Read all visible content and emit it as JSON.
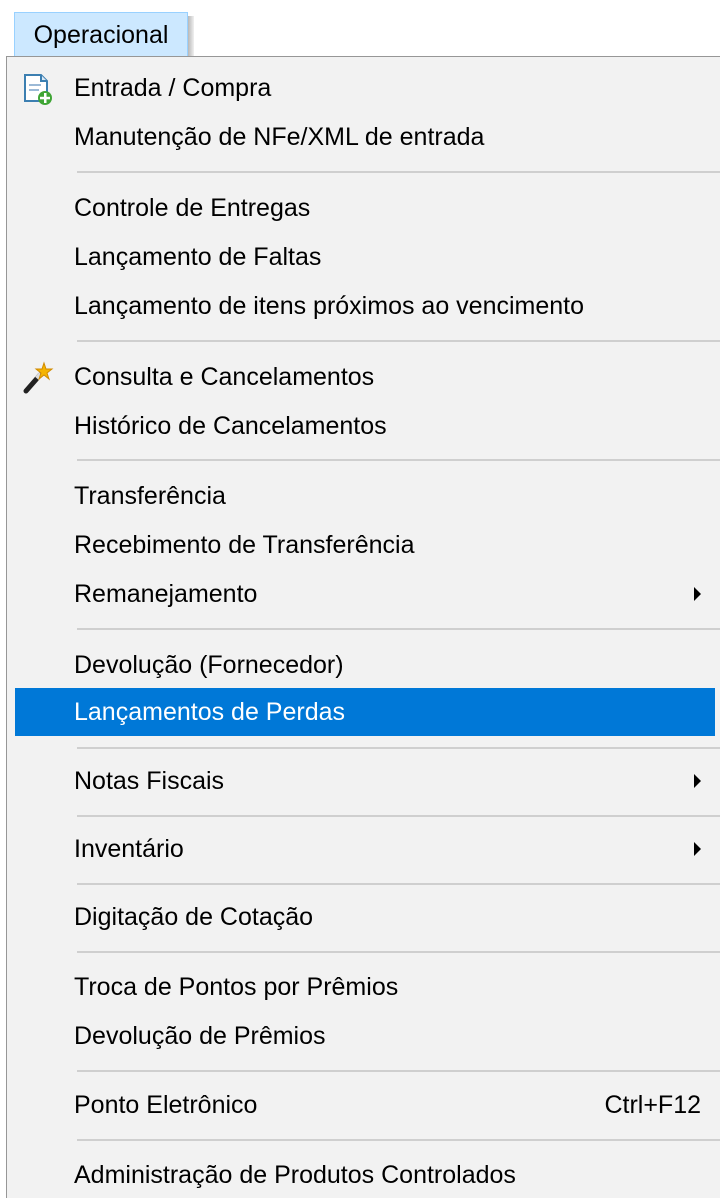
{
  "menubar": {
    "active_menu": "Operacional"
  },
  "menu": {
    "items": [
      {
        "label": "Entrada / Compra",
        "icon": "document-add-icon"
      },
      {
        "label": "Manutenção de NFe/XML de entrada"
      },
      {
        "label": "Controle de Entregas"
      },
      {
        "label": "Lançamento de Faltas"
      },
      {
        "label": "Lançamento de itens próximos ao vencimento"
      },
      {
        "label": "Consulta e Cancelamentos",
        "icon": "magic-wand-icon"
      },
      {
        "label": "Histórico de Cancelamentos"
      },
      {
        "label": "Transferência"
      },
      {
        "label": "Recebimento de Transferência"
      },
      {
        "label": "Remanejamento",
        "submenu": true
      },
      {
        "label": "Devolução (Fornecedor)"
      },
      {
        "label": "Lançamentos de Perdas",
        "highlighted": true
      },
      {
        "label": "Notas Fiscais",
        "submenu": true
      },
      {
        "label": "Inventário",
        "submenu": true
      },
      {
        "label": "Digitação de Cotação"
      },
      {
        "label": "Troca de Pontos por Prêmios"
      },
      {
        "label": "Devolução de Prêmios"
      },
      {
        "label": "Ponto Eletrônico",
        "shortcut": "Ctrl+F12"
      },
      {
        "label": "Administração de Produtos Controlados"
      }
    ]
  },
  "colors": {
    "highlight": "#0078d7",
    "menu_background": "#f2f2f2",
    "menubar_active": "#cce8ff"
  }
}
